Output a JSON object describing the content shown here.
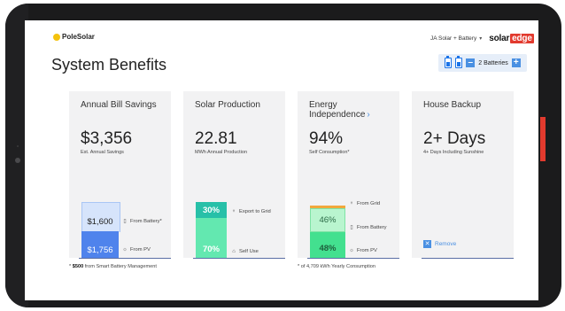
{
  "header": {
    "brand_name": "PoleSolar",
    "system_select": "JA Solar + Battery",
    "se_logo_left": "solar",
    "se_logo_right": "edge",
    "page_title": "System Benefits"
  },
  "batteries": {
    "count_label": "2 Batteries",
    "minus": "–",
    "plus": "+"
  },
  "cards": {
    "bill": {
      "title": "Annual Bill Savings",
      "value": "$3,356",
      "sub": "Est. Annual Savings",
      "battery_value": "$1,600",
      "battery_label": "From Battery*",
      "pv_value": "$1,756",
      "pv_label": "From PV",
      "footnote_strong": "$500",
      "footnote_rest": " from Smart Battery Management",
      "footnote_star": "* "
    },
    "solar": {
      "title": "Solar Production",
      "value": "22.81",
      "sub": "MWh Annual Production",
      "export_pct": "30%",
      "export_label": "Export to Grid",
      "self_pct": "70%",
      "self_label": "Self Use"
    },
    "energy": {
      "title": "Energy Independence",
      "value": "94%",
      "sub": "Self Consumption*",
      "grid_label": "From Grid",
      "battery_pct": "46%",
      "battery_label": "From Battery",
      "pv_pct": "48%",
      "pv_label": "From PV",
      "footnote": "* of 4,709 kWh Yearly Consumption"
    },
    "backup": {
      "title": "House Backup",
      "value": "2+ Days",
      "sub": "4+ Days Including Sunshine",
      "remove_label": "Remove"
    }
  },
  "colors": {
    "accent": "#4a90e2",
    "brand_yellow": "#f4c20d",
    "solaredge_red": "#e23a2e",
    "teal": "#3ed6b4",
    "green": "#3ee08b"
  },
  "icons": [
    "battery-icon",
    "tower-icon",
    "sun-icon",
    "house-icon",
    "close-icon",
    "chevron-right-icon"
  ]
}
